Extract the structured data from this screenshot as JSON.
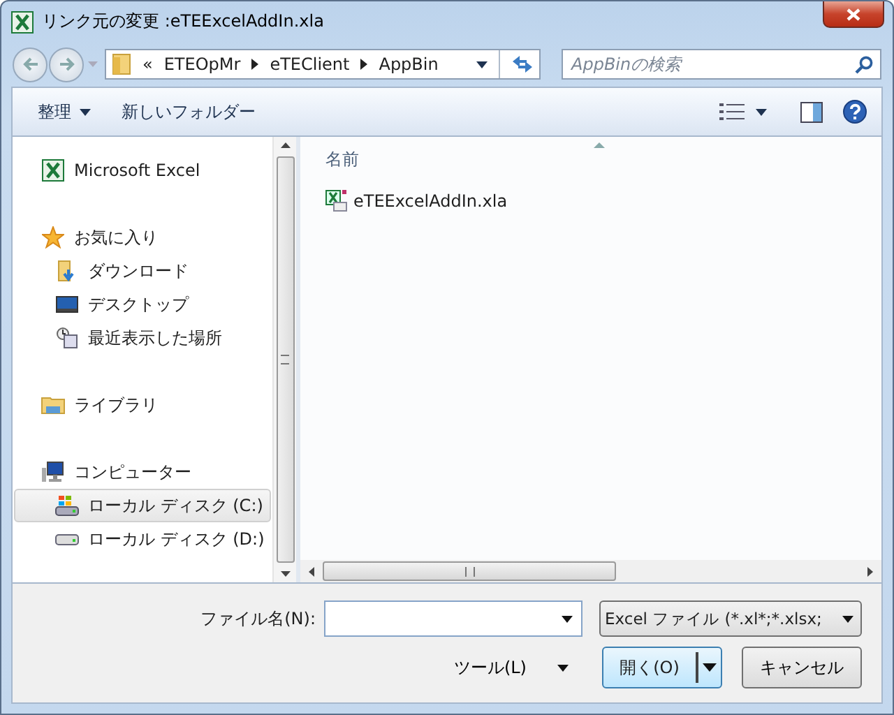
{
  "window": {
    "title": "リンク元の変更 :eTEExcelAddIn.xla"
  },
  "breadcrumb": {
    "overflow": "«",
    "segments": [
      "ETEOpMr",
      "eTEClient",
      "AppBin"
    ]
  },
  "search": {
    "placeholder": "AppBinの検索"
  },
  "toolbar": {
    "organize": "整理",
    "new_folder": "新しいフォルダー"
  },
  "sidebar": {
    "groups": [
      {
        "label": "Microsoft Excel",
        "kind": "excel",
        "selected": false
      },
      {
        "label": "お気に入り",
        "kind": "star",
        "selected": false,
        "children": [
          {
            "label": "ダウンロード",
            "kind": "download",
            "selected": false
          },
          {
            "label": "デスクトップ",
            "kind": "desktop",
            "selected": false
          },
          {
            "label": "最近表示した場所",
            "kind": "recent",
            "selected": false
          }
        ]
      },
      {
        "label": "ライブラリ",
        "kind": "library",
        "selected": false
      },
      {
        "label": "コンピューター",
        "kind": "computer",
        "selected": false,
        "children": [
          {
            "label": "ローカル ディスク (C:)",
            "kind": "system-drive",
            "selected": true
          },
          {
            "label": "ローカル ディスク (D:)",
            "kind": "drive",
            "selected": false
          }
        ]
      }
    ]
  },
  "file_list": {
    "column": "名前",
    "files": [
      {
        "name": "eTEExcelAddIn.xla"
      }
    ]
  },
  "file_name": {
    "label": "ファイル名(N):"
  },
  "file_type": {
    "value": "Excel ファイル (*.xl*;*.xlsx;"
  },
  "tools": {
    "label": "ツール(L)"
  },
  "buttons": {
    "open": "開く(O)",
    "cancel": "キャンセル"
  }
}
